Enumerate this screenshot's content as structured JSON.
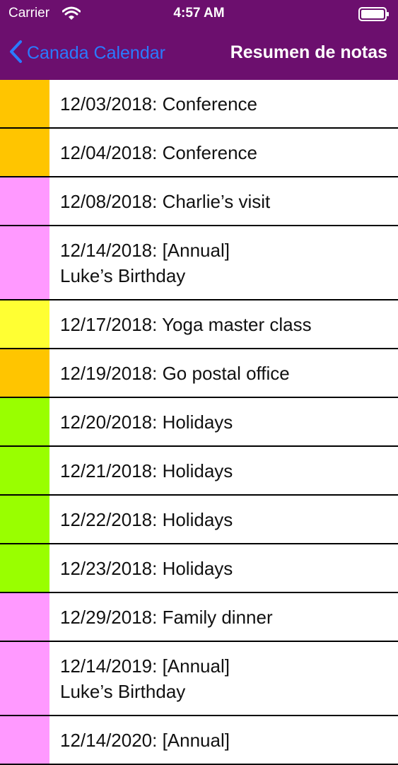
{
  "status_bar": {
    "carrier": "Carrier",
    "time": "4:57 AM"
  },
  "nav": {
    "back_label": "Canada Calendar",
    "title": "Resumen de notas",
    "bar_color": "#6c0f6e",
    "accent_color": "#2a7bff"
  },
  "notes": [
    {
      "text": "12/03/2018: Conference",
      "color": "#ffc500"
    },
    {
      "text": "12/04/2018: Conference",
      "color": "#ffc500"
    },
    {
      "text": "12/08/2018: Charlie’s visit",
      "color": "#ff99ff"
    },
    {
      "text": "12/14/2018: [Annual]\nLuke’s Birthday",
      "color": "#ff99ff"
    },
    {
      "text": "12/17/2018: Yoga master class",
      "color": "#ffff33"
    },
    {
      "text": "12/19/2018: Go postal office",
      "color": "#ffc500"
    },
    {
      "text": "12/20/2018: Holidays",
      "color": "#99ff00"
    },
    {
      "text": "12/21/2018: Holidays",
      "color": "#99ff00"
    },
    {
      "text": "12/22/2018: Holidays",
      "color": "#99ff00"
    },
    {
      "text": "12/23/2018: Holidays",
      "color": "#99ff00"
    },
    {
      "text": "12/29/2018: Family dinner",
      "color": "#ff99ff"
    },
    {
      "text": "12/14/2019: [Annual]\nLuke’s Birthday",
      "color": "#ff99ff"
    },
    {
      "text": "12/14/2020: [Annual]",
      "color": "#ff99ff"
    }
  ]
}
